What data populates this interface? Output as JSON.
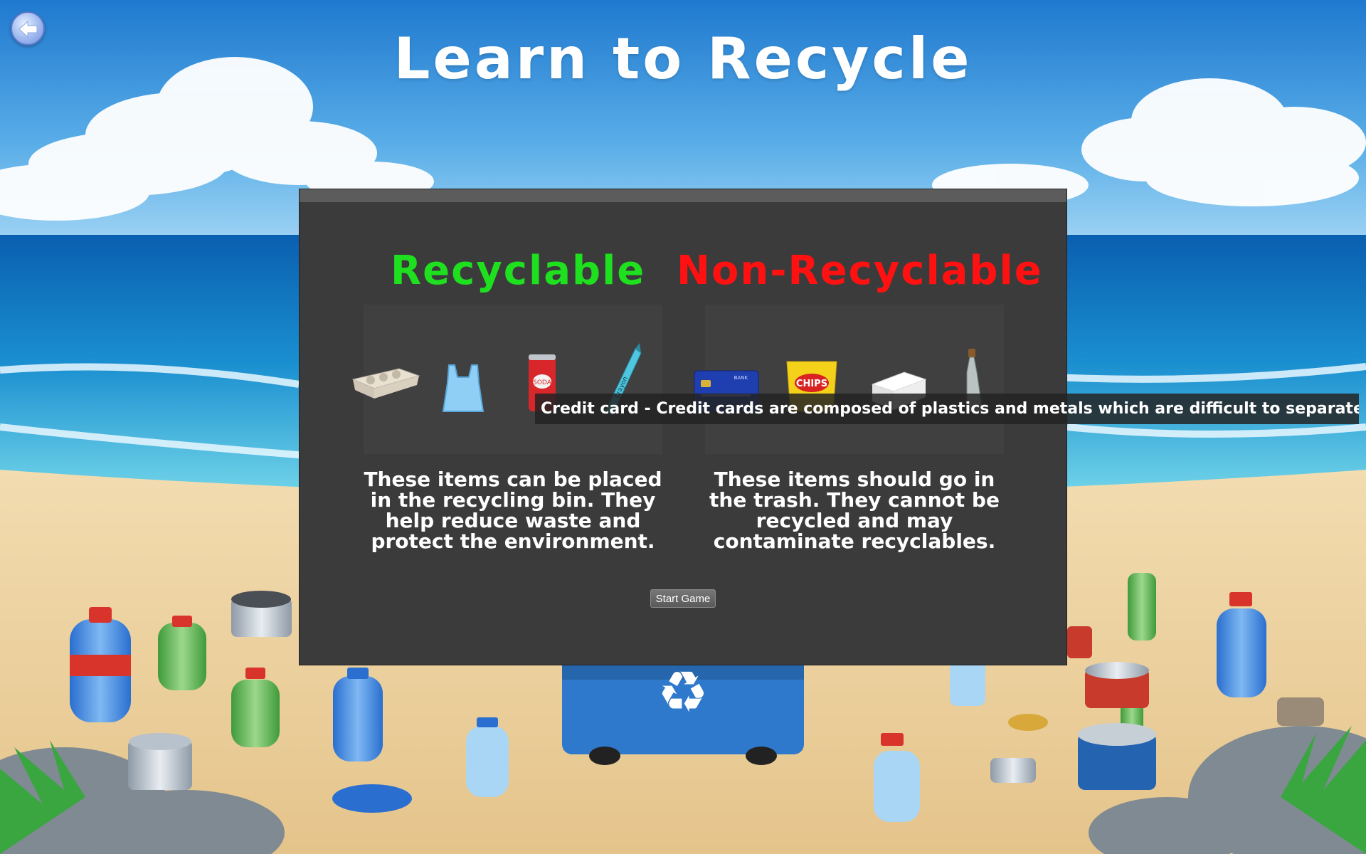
{
  "page": {
    "title": "Learn to Recycle"
  },
  "panel": {
    "recyclable": {
      "heading": "Recyclable",
      "heading_color": "#1ee01e",
      "description": "These items can be placed in the recycling bin. They help reduce waste and protect the environment.",
      "items": [
        {
          "icon": "egg-carton-icon"
        },
        {
          "icon": "plastic-bag-icon"
        },
        {
          "icon": "soda-can-icon",
          "label": "SODA"
        },
        {
          "icon": "crayon-icon",
          "label": "Crayon"
        }
      ]
    },
    "non_recyclable": {
      "heading": "Non-Recyclable",
      "heading_color": "#ff1111",
      "description": "These items should go in the trash. They cannot be recycled and may contaminate recyclables.",
      "items": [
        {
          "icon": "credit-card-icon",
          "label": "BANK"
        },
        {
          "icon": "chips-bag-icon",
          "label": "CHIPS"
        },
        {
          "icon": "styrofoam-container-icon"
        },
        {
          "icon": "glass-bottle-icon"
        }
      ]
    },
    "start_button": "Start Game"
  },
  "tooltip": {
    "text": "Credit card - Credit cards are composed of plastics and metals which are difficult to separate"
  }
}
